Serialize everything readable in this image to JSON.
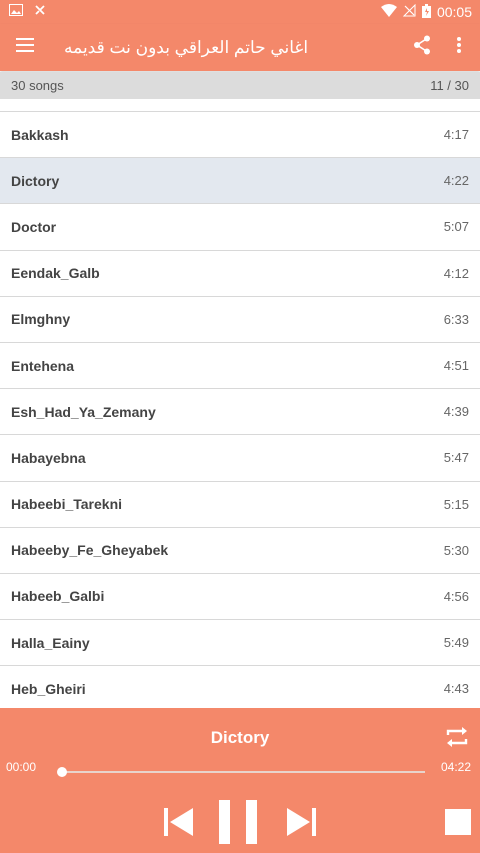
{
  "status_bar": {
    "time": "00:05"
  },
  "app_bar": {
    "title": "اغاني حاتم العراقي بدون نت قديمه"
  },
  "list_header": {
    "count": "30 songs",
    "position": "11 / 30"
  },
  "songs": [
    {
      "title": "Bakkash",
      "duration": "4:17"
    },
    {
      "title": "Dictory",
      "duration": "4:22"
    },
    {
      "title": "Doctor",
      "duration": "5:07"
    },
    {
      "title": "Eendak_Galb",
      "duration": "4:12"
    },
    {
      "title": "Elmghny",
      "duration": "6:33"
    },
    {
      "title": "Entehena",
      "duration": "4:51"
    },
    {
      "title": "Esh_Had_Ya_Zemany",
      "duration": "4:39"
    },
    {
      "title": "Habayebna",
      "duration": "5:47"
    },
    {
      "title": "Habeebi_Tarekni",
      "duration": "5:15"
    },
    {
      "title": "Habeeby_Fe_Gheyabek",
      "duration": "5:30"
    },
    {
      "title": "Habeeb_Galbi",
      "duration": "4:56"
    },
    {
      "title": "Halla_Eainy",
      "duration": "5:49"
    },
    {
      "title": "Heb_Gheiri",
      "duration": "4:43"
    }
  ],
  "player": {
    "now_playing": "Dictory",
    "current_time": "00:00",
    "total_time": "04:22",
    "progress": 0
  },
  "colors": {
    "accent": "#f4886a",
    "selected_row": "#e3e8ef",
    "header_bg": "#dcdcdc"
  }
}
